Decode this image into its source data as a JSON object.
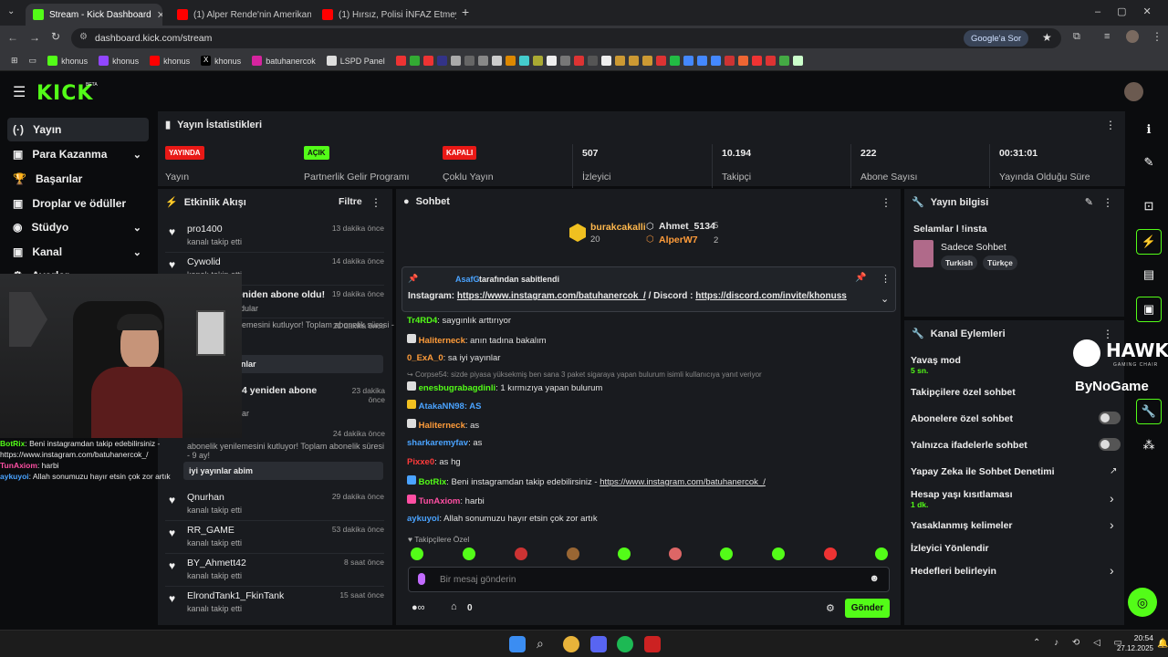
{
  "browser": {
    "tabs": [
      {
        "title": "Stream - Kick Dashboard",
        "color": "#53fc18"
      },
      {
        "title": "(1) Alper Rende'nin Amerikan P",
        "color": "#ff0000"
      },
      {
        "title": "(1) Hırsız, Polisi İNFAZ Etmeye Ç",
        "color": "#ff0000"
      }
    ],
    "new_tab": "+",
    "url": "dashboard.kick.com/stream",
    "google_btn": "Google'a Sor",
    "bookmarks": [
      "khonus",
      "khonus",
      "khonus",
      "khonus",
      "batuhanercok",
      "LSPD Panel"
    ]
  },
  "kick": {
    "logo": "KICK",
    "logo_sup": "BETA"
  },
  "sidebar": {
    "items": [
      {
        "label": "Yayın",
        "icon": "(·)"
      },
      {
        "label": "Para Kazanma",
        "icon": "▣"
      },
      {
        "label": "Başarılar",
        "icon": "🏆"
      },
      {
        "label": "Droplar ve ödüller",
        "icon": "▣"
      },
      {
        "label": "Stüdyo",
        "icon": "◉"
      },
      {
        "label": "Kanal",
        "icon": "▣"
      },
      {
        "label": "Ayarlar",
        "icon": "⚙"
      }
    ]
  },
  "stats": {
    "title": "Yayın İstatistikleri",
    "cells": [
      {
        "badge": "YAYINDA",
        "label": "Yayın"
      },
      {
        "badge": "AÇIK",
        "label": "Partnerlik Gelir Programı"
      },
      {
        "badge": "KAPALI",
        "label": "Çoklu Yayın"
      },
      {
        "value": "507",
        "label": "İzleyici"
      },
      {
        "value": "10.194",
        "label": "Takipçi"
      },
      {
        "value": "222",
        "label": "Abone Sayısı"
      },
      {
        "value": "00:31:01",
        "label": "Yayında Olduğu Süre"
      }
    ]
  },
  "activity": {
    "title": "Etkinlik Akışı",
    "filter": "Filtre",
    "items": [
      {
        "name": "pro1400",
        "sub": "kanalı takip etti",
        "time": "13 dakika önce"
      },
      {
        "name": "Cywolid",
        "sub": "kanalı takip etti",
        "time": "14 dakika önce"
      },
      {
        "name": "OnurSLR yeniden abone oldu!",
        "sub": "dular",
        "time": "19 dakika önce"
      },
      {
        "name": "",
        "sub": "lemesini kutluyor! Toplam abonelik süresi -",
        "time": "21 dakika önce"
      },
      {
        "name": "4 yeniden abone",
        "sub": "dular",
        "time": "23 dakika önce"
      },
      {
        "name": "",
        "sub": "abonelik yenilemesini kutluyor! Toplam abonelik süresi - 9 ay!",
        "time": "24 dakika önce"
      },
      {
        "name": "Qnurhan",
        "sub": "kanalı takip etti",
        "time": "29 dakika önce"
      },
      {
        "name": "RR_GAME",
        "sub": "kanalı takip etti",
        "time": "53 dakika önce"
      },
      {
        "name": "BY_Ahmett42",
        "sub": "kanalı takip etti",
        "time": "8 saat önce"
      },
      {
        "name": "ElrondTank1_FkinTank",
        "sub": "kanalı takip etti",
        "time": "15 saat önce"
      }
    ],
    "msg1": "ynlar",
    "msg2": "iyi yayınlar abim"
  },
  "webcam_chat": [
    {
      "user": "BotRix",
      "text": ": Beni instagramdan takip edebilirsiniz - https://www.instagram.com/batuhanercok_/",
      "color": "#53fc18"
    },
    {
      "user": "TunAxiom",
      "text": ": harbi",
      "color": "#ff4fa3"
    },
    {
      "user": "aykuyoi",
      "text": ": Allah sonumuzu hayır etsin çok zor artık",
      "color": "#4aa3ff"
    }
  ],
  "hawk": {
    "line1": "HAWK",
    "line2": "GAMING CHAIR",
    "line3": "ByNoGame"
  },
  "chat": {
    "title": "Sohbet",
    "top": [
      {
        "name": "burakcakalli",
        "count": "20"
      },
      {
        "name": "Ahmet_5134",
        "count": "5"
      },
      {
        "name": "AlperW7",
        "count": "2"
      }
    ],
    "pinned_by": "AsafG",
    "pinned_suffix": "tarafından sabitlendi",
    "pinned_text_prefix": "Instagram: ",
    "pinned_link1": "https://www.instagram.com/batuhanercok_/",
    "pinned_mid": " / Discord : ",
    "pinned_link2": "https://discord.com/invite/khonuss",
    "messages": [
      {
        "user": "Tr4RD4",
        "text": ": saygınlık arttırıyor",
        "color": "#53fc18"
      },
      {
        "user": "Haliterneck",
        "text": ": anın tadına bakalım",
        "color": "#ff9c3a"
      },
      {
        "user": "0_ExA_0",
        "text": ": sa iyi yayınlar",
        "color": "#ff9c3a"
      },
      {
        "user": "",
        "text": "Corpse54: sizde piyasa yüksekmiş ben sana 3 paket sigaraya yapan bulurum isimli kullanıcıya yanıt veriyor",
        "color": "#888"
      },
      {
        "user": "enesbugrabagdinli",
        "text": ": 1 kırmızıya yapan bulurum",
        "color": "#53fc18"
      },
      {
        "user": "AtakaNN98",
        "text": ": AS",
        "color": "#4aa3ff"
      },
      {
        "user": "Haliterneck",
        "text": ": as",
        "color": "#ff9c3a"
      },
      {
        "user": "sharkaremyfav",
        "text": ": as",
        "color": "#4aa3ff"
      },
      {
        "user": "Pixxe0",
        "text": ": as hg",
        "color": "#ff3b3b"
      },
      {
        "user": "BotRix",
        "text": ": Beni instagramdan takip edebilirsiniz - ",
        "link": "https://www.instagram.com/batuhanercok_/",
        "color": "#53fc18"
      },
      {
        "user": "TunAxiom",
        "text": ": harbi",
        "color": "#ff4fa3"
      },
      {
        "user": "aykuyoi",
        "text": ": Allah sonumuzu hayır etsin çok zor artık",
        "color": "#4aa3ff"
      }
    ],
    "mode": "Takipçilere Özel",
    "placeholder": "Bir mesaj gönderin",
    "points": "0",
    "send": "Gönder"
  },
  "stream_info": {
    "title": "Yayın bilgisi",
    "stream_title": "Selamlar l !insta",
    "category": "Sadece Sohbet",
    "tags": [
      "Turkish",
      "Türkçe"
    ]
  },
  "channel_actions": {
    "title": "Kanal Eylemleri",
    "slow_mode": "Yavaş mod",
    "slow_value": "5 sn.",
    "followers_only": "Takipçilere özel sohbet",
    "subs_only": "Abonelere özel sohbet",
    "emotes_only": "Yalnızca ifadelerle sohbet",
    "ai_mod": "Yapay Zeka ile Sohbet Denetimi",
    "age_limit": "Hesap yaşı kısıtlaması",
    "age_value": "1 dk.",
    "banned_words": "Yasaklanmış kelimeler",
    "viewer_redirect": "İzleyici Yönlendir",
    "goals": "Hedefleri belirleyin"
  },
  "taskbar": {
    "time": "20:54",
    "date": "27.12.2025"
  },
  "colors": {
    "kick_green": "#53fc18",
    "live_red": "#e91916"
  }
}
